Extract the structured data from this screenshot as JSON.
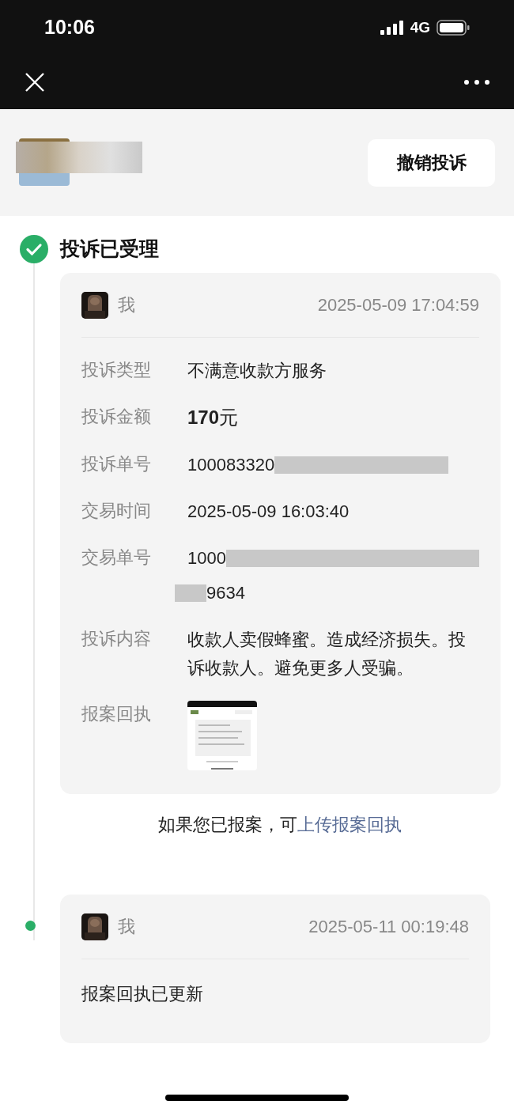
{
  "status_bar": {
    "time": "10:06",
    "network": "4G"
  },
  "header": {
    "button": "撤销投诉"
  },
  "timeline": [
    {
      "kind": "done",
      "title": "投诉已受理",
      "card": {
        "author": "我",
        "time": "2025-05-09 17:04:59",
        "fields": [
          {
            "kind": "text",
            "label": "投诉类型",
            "value": "不满意收款方服务"
          },
          {
            "kind": "amount",
            "label": "投诉金额",
            "value": "**170**元"
          },
          {
            "kind": "redacted",
            "label": "投诉单号",
            "value": "100083320"
          },
          {
            "kind": "text",
            "label": "交易时间",
            "value": "2025-05-09 16:03:40"
          },
          {
            "kind": "redacted_wrap",
            "label": "交易单号",
            "parts": [
              "1000",
              "9634"
            ]
          },
          {
            "kind": "text",
            "label": "投诉内容",
            "value": "收款人卖假蜂蜜。造成经济损失。投诉收款人。避免更多人受骗。"
          },
          {
            "label": "报案回执"
          }
        ]
      },
      "footer": {
        "text": "如果您已报案，可",
        "link": "上传报案回执"
      }
    },
    {
      "kind": "dot",
      "card": {
        "author": "我",
        "time": "2025-05-11 00:19:48",
        "message": "报案回执已更新"
      }
    }
  ]
}
